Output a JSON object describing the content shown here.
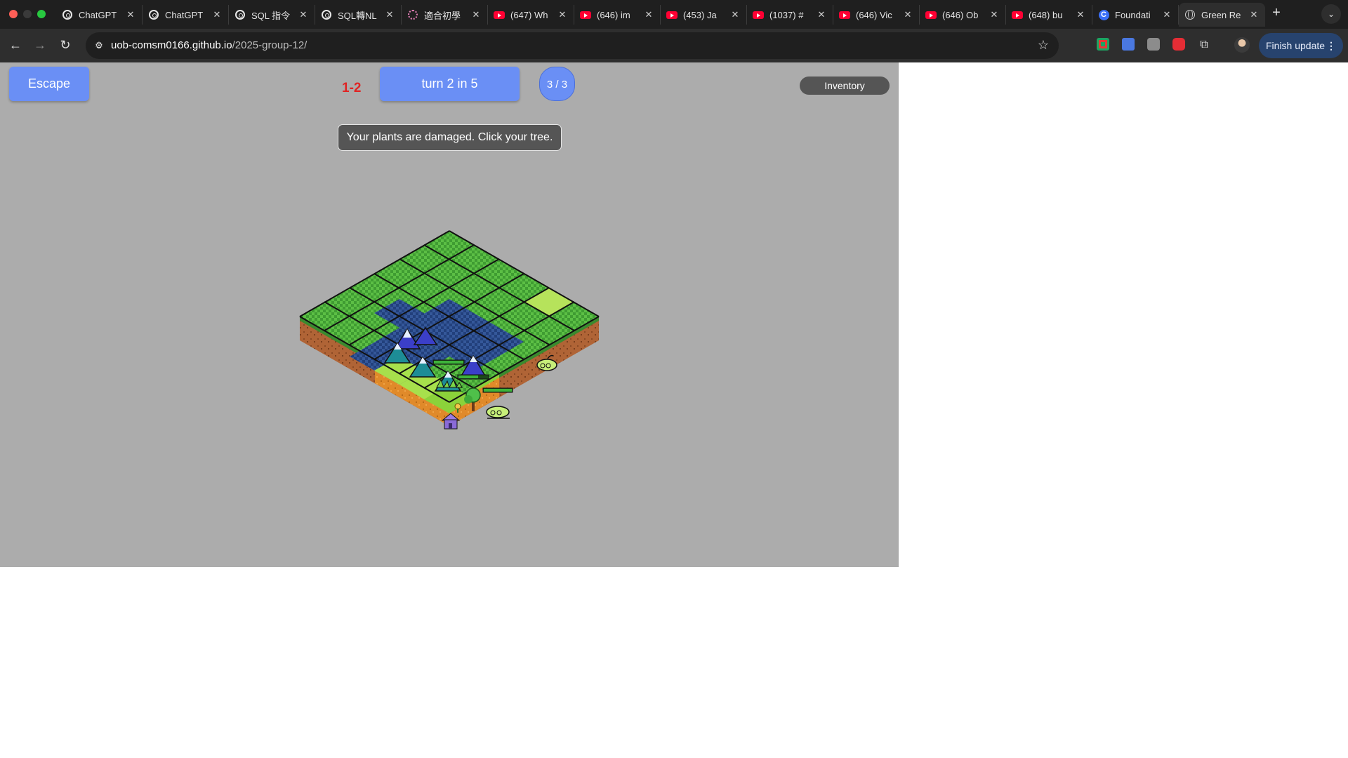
{
  "browser": {
    "tabs": [
      {
        "title": "ChatGPT",
        "icon": "chatgpt-icon"
      },
      {
        "title": "ChatGPT",
        "icon": "chatgpt-icon"
      },
      {
        "title": "SQL 指令",
        "icon": "chatgpt-icon"
      },
      {
        "title": "SQL轉NL",
        "icon": "chatgpt-icon"
      },
      {
        "title": "適合初學",
        "icon": "dotted-circle-icon"
      },
      {
        "title": "(647) Wh",
        "icon": "youtube-icon"
      },
      {
        "title": "(646) im",
        "icon": "youtube-icon"
      },
      {
        "title": "(453) Ja",
        "icon": "youtube-icon"
      },
      {
        "title": "(1037) #",
        "icon": "youtube-icon"
      },
      {
        "title": "(646) Vic",
        "icon": "youtube-icon"
      },
      {
        "title": "(646) Ob",
        "icon": "youtube-icon"
      },
      {
        "title": "(648) bu",
        "icon": "youtube-icon"
      },
      {
        "title": "Foundati",
        "icon": "c-icon"
      },
      {
        "title": "Green Re",
        "icon": "globe-icon",
        "active": true
      }
    ],
    "url": {
      "host": "uob-comsm0166.github.io",
      "path": "/2025-group-12/"
    },
    "finish_update_label": "Finish update",
    "finish_update_menu": "⋮",
    "colors": {
      "tabstrip": "#1f1f1f",
      "toolbar": "#2e2e2e",
      "finish_update": "#27436e"
    }
  },
  "game": {
    "escape_label": "Escape",
    "level_label": "1-2",
    "turn_label": "turn 2 in 5",
    "count_label": "3 / 3",
    "inventory_label": "Inventory",
    "message": "Your plants are damaged. Click your tree.",
    "colors": {
      "background": "#acacac",
      "button": "#6a8ff5",
      "level_text": "#e02424",
      "grass": "#4caf3c",
      "water": "#2c4d8c",
      "soil": "#b5683a"
    }
  }
}
